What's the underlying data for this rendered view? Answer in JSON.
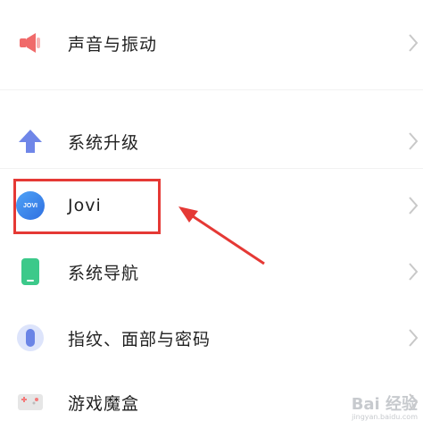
{
  "settings": {
    "items": [
      {
        "label": "声音与振动",
        "icon": "speaker-icon"
      },
      {
        "label": "系统升级",
        "icon": "arrow-up-icon"
      },
      {
        "label": "Jovi",
        "icon": "jovi-icon",
        "icon_text": "JOVI"
      },
      {
        "label": "系统导航",
        "icon": "phone-icon"
      },
      {
        "label": "指纹、面部与密码",
        "icon": "fingerprint-icon"
      },
      {
        "label": "游戏魔盒",
        "icon": "game-box-icon"
      }
    ]
  },
  "annotation": {
    "color": "#e53935"
  },
  "watermark": {
    "brand": "Bai 经验",
    "sub": "jingyan.baidu.com"
  }
}
